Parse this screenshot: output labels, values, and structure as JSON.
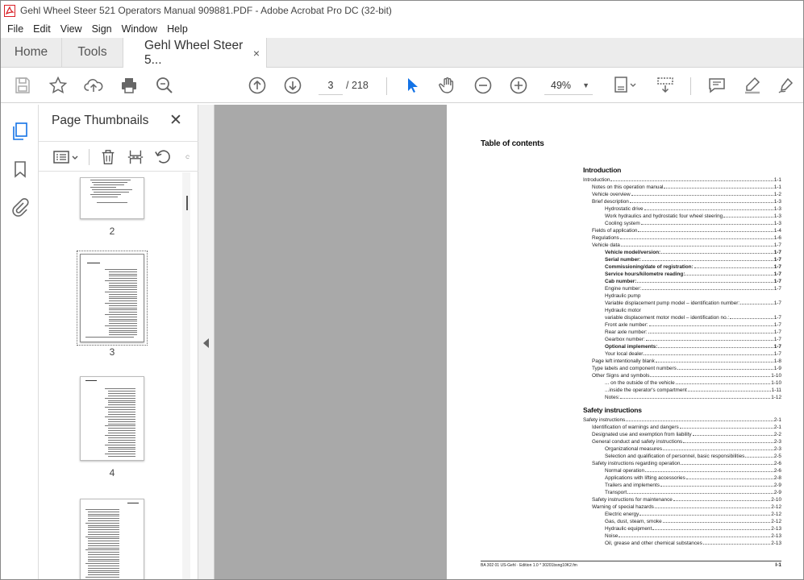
{
  "window": {
    "title": "Gehl Wheel Steer 521 Operators Manual 909881.PDF - Adobe Acrobat Pro DC (32-bit)"
  },
  "menu": [
    "File",
    "Edit",
    "View",
    "Sign",
    "Window",
    "Help"
  ],
  "tabs": {
    "home": "Home",
    "tools": "Tools",
    "doc": "Gehl Wheel Steer 5...",
    "close": "×"
  },
  "toolbar": {
    "current_page": "3",
    "total_pages": "/ 218",
    "zoom": "49%",
    "zoom_caret": "▼"
  },
  "panel": {
    "title": "Page Thumbnails",
    "close": "✕"
  },
  "thumbnails": [
    {
      "label": "2"
    },
    {
      "label": "3"
    },
    {
      "label": "4"
    }
  ],
  "page": {
    "title": "Table of contents",
    "sections": [
      {
        "heading": "Introduction",
        "entries": [
          {
            "text": "Introduction",
            "page": "1-1",
            "indent": 0,
            "bold": false
          },
          {
            "text": "Notes on this operation manual",
            "page": "1-1",
            "indent": 1,
            "bold": false
          },
          {
            "text": "Vehicle overview",
            "page": "1-2",
            "indent": 1,
            "bold": false
          },
          {
            "text": "Brief description",
            "page": "1-3",
            "indent": 1,
            "bold": false
          },
          {
            "text": "Hydrostatic drive",
            "page": "1-3",
            "indent": 2,
            "bold": false
          },
          {
            "text": "Work hydraulics and hydrostatic four wheel steering",
            "page": "1-3",
            "indent": 2,
            "bold": false
          },
          {
            "text": "Cooling system",
            "page": "1-3",
            "indent": 2,
            "bold": false
          },
          {
            "text": "Fields of application",
            "page": "1-4",
            "indent": 1,
            "bold": false
          },
          {
            "text": "Regulations",
            "page": "1-6",
            "indent": 1,
            "bold": false
          },
          {
            "text": "Vehicle data",
            "page": "1-7",
            "indent": 1,
            "bold": false
          },
          {
            "text": "Vehicle model/version:",
            "page": "1-7",
            "indent": 2,
            "bold": true
          },
          {
            "text": "Serial number:",
            "page": "1-7",
            "indent": 2,
            "bold": true
          },
          {
            "text": "Commissioning/date of registration:",
            "page": "1-7",
            "indent": 2,
            "bold": true
          },
          {
            "text": "Service hours/kilometre reading:",
            "page": "1-7",
            "indent": 2,
            "bold": true
          },
          {
            "text": "Cab number:",
            "page": "1-7",
            "indent": 2,
            "bold": true
          },
          {
            "text": "Engine number:",
            "page": "1-7",
            "indent": 2,
            "bold": false
          },
          {
            "text": "Hydraulic pump",
            "page": "",
            "indent": 2,
            "bold": false
          },
          {
            "text": "Variable displacement pump model – identification number:",
            "page": "1-7",
            "indent": 2,
            "bold": false
          },
          {
            "text": "Hydraulic motor",
            "page": "",
            "indent": 2,
            "bold": false
          },
          {
            "text": "variable displacement motor model – identification no.:",
            "page": "1-7",
            "indent": 2,
            "bold": false
          },
          {
            "text": "Front axle number:",
            "page": "1-7",
            "indent": 2,
            "bold": false
          },
          {
            "text": "Rear axle number:",
            "page": "1-7",
            "indent": 2,
            "bold": false
          },
          {
            "text": "Gearbox number:",
            "page": "1-7",
            "indent": 2,
            "bold": false
          },
          {
            "text": "Optional implements:",
            "page": "1-7",
            "indent": 2,
            "bold": true
          },
          {
            "text": "Your local dealer",
            "page": "1-7",
            "indent": 2,
            "bold": false
          },
          {
            "text": "Page left intentionally blank",
            "page": "1-8",
            "indent": 1,
            "bold": false
          },
          {
            "text": "Type labels and component numbers",
            "page": "1-9",
            "indent": 1,
            "bold": false
          },
          {
            "text": "Other Signs and symbols",
            "page": "1-10",
            "indent": 1,
            "bold": false
          },
          {
            "text": "... on the outside of the vehicle",
            "page": "1-10",
            "indent": 2,
            "bold": false
          },
          {
            "text": "...inside the operator's compartment",
            "page": "1-11",
            "indent": 2,
            "bold": false
          },
          {
            "text": "Notes:",
            "page": "1-12",
            "indent": 2,
            "bold": false
          }
        ]
      },
      {
        "heading": "Safety instructions",
        "entries": [
          {
            "text": "Safety instructions",
            "page": "2-1",
            "indent": 0,
            "bold": false
          },
          {
            "text": "Identification of warnings and dangers",
            "page": "2-1",
            "indent": 1,
            "bold": false
          },
          {
            "text": "Designated use and exemption from liability",
            "page": "2-2",
            "indent": 1,
            "bold": false
          },
          {
            "text": "General conduct and safety instructions",
            "page": "2-3",
            "indent": 1,
            "bold": false
          },
          {
            "text": "Organizational measures",
            "page": "2-3",
            "indent": 2,
            "bold": false
          },
          {
            "text": "Selection and qualification of personnel, basic responsibilities",
            "page": "2-5",
            "indent": 2,
            "bold": false
          },
          {
            "text": "Safety instructions regarding operation",
            "page": "2-6",
            "indent": 1,
            "bold": false
          },
          {
            "text": "Normal operation",
            "page": "2-6",
            "indent": 2,
            "bold": false
          },
          {
            "text": "Applications with lifting accessories",
            "page": "2-8",
            "indent": 2,
            "bold": false
          },
          {
            "text": "Trailers and implements",
            "page": "2-9",
            "indent": 2,
            "bold": false
          },
          {
            "text": "Transport",
            "page": "2-9",
            "indent": 2,
            "bold": false
          },
          {
            "text": "Safety instructions for maintenance",
            "page": "2-10",
            "indent": 1,
            "bold": false
          },
          {
            "text": "Warning of special hazards",
            "page": "2-12",
            "indent": 1,
            "bold": false
          },
          {
            "text": "Electric energy",
            "page": "2-12",
            "indent": 2,
            "bold": false
          },
          {
            "text": "Gas, dust, steam, smoke",
            "page": "2-12",
            "indent": 2,
            "bold": false
          },
          {
            "text": "Hydraulic equipment",
            "page": "2-13",
            "indent": 2,
            "bold": false
          },
          {
            "text": "Noise",
            "page": "2-13",
            "indent": 2,
            "bold": false
          },
          {
            "text": "Oil, grease and other chemical substances",
            "page": "2-13",
            "indent": 2,
            "bold": false
          }
        ]
      }
    ],
    "footer_left": "BA 302 01 US-Gehl · Edition 1.0 * 30201bsng10K2.fm",
    "footer_right": "I-1"
  }
}
